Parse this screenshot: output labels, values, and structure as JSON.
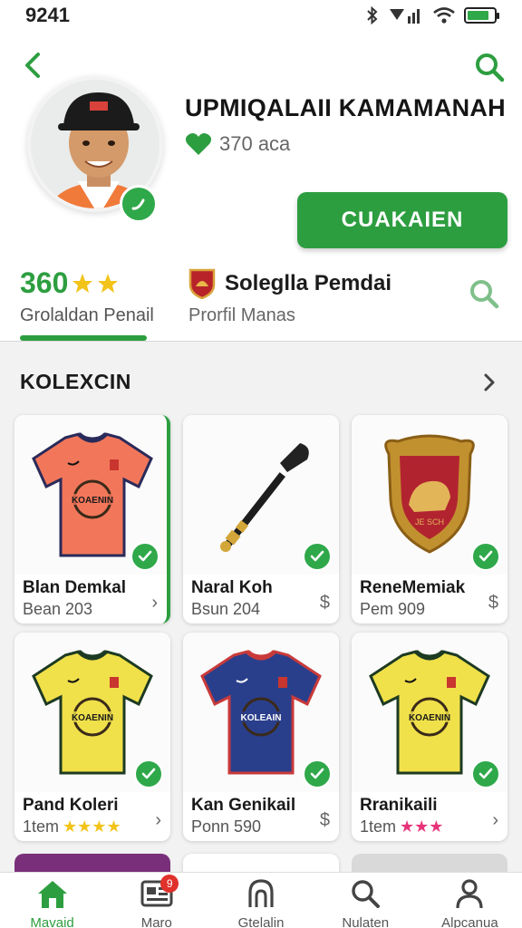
{
  "status_bar": {
    "time": "9241"
  },
  "profile": {
    "name": "UPMIQALAII KAMAMANAH",
    "likes": "370 aca",
    "cta_label": "CUAKAIEN"
  },
  "stats": {
    "points_value": "360",
    "points_label": "Grolaldan Penail",
    "club_name": "Soleglla Pemdai",
    "club_sub": "Prorfil Manas"
  },
  "collection": {
    "title": "KOLEXCIN",
    "items": [
      {
        "title": "Blan Demkal",
        "sub": "Bean 203",
        "trail": "›",
        "kind": "jersey",
        "color": "#f2775a",
        "crest_text": "KOAENIN"
      },
      {
        "title": "Naral Koh",
        "sub": "Bsun 204",
        "trail": "$",
        "kind": "scarf"
      },
      {
        "title": "RenеMemiak",
        "sub": "Pem 909",
        "trail": "$",
        "kind": "badge",
        "crest_text": "JE SCH"
      },
      {
        "title": "Pand Koleri",
        "sub": "1tem",
        "trail": "›",
        "kind": "jersey",
        "color": "#f0e04a",
        "crest_text": "KOAENIN",
        "stars": "★★★★"
      },
      {
        "title": "Kan Genikail",
        "sub": "Ponn 590",
        "trail": "$",
        "kind": "jersey",
        "color": "#2a3f8c",
        "crest_text": "KOLEAIN"
      },
      {
        "title": "Rranikaili",
        "sub": "1tem",
        "trail": "›",
        "kind": "jersey",
        "color": "#f0e04a",
        "crest_text": "KOAENIN",
        "stars": "★★★"
      }
    ]
  },
  "bottom_nav": [
    {
      "label": "Mavaid",
      "icon": "home-icon",
      "active": true
    },
    {
      "label": "Maro",
      "icon": "news-icon",
      "badge": "9"
    },
    {
      "label": "Gtelalin",
      "icon": "arch-icon"
    },
    {
      "label": "Nulaten",
      "icon": "search-icon"
    },
    {
      "label": "Alpcanua",
      "icon": "user-icon"
    }
  ],
  "colors": {
    "accent": "#2d9e40",
    "badge": "#e0312b",
    "star": "#f2c319",
    "pink_star": "#e8337a"
  }
}
